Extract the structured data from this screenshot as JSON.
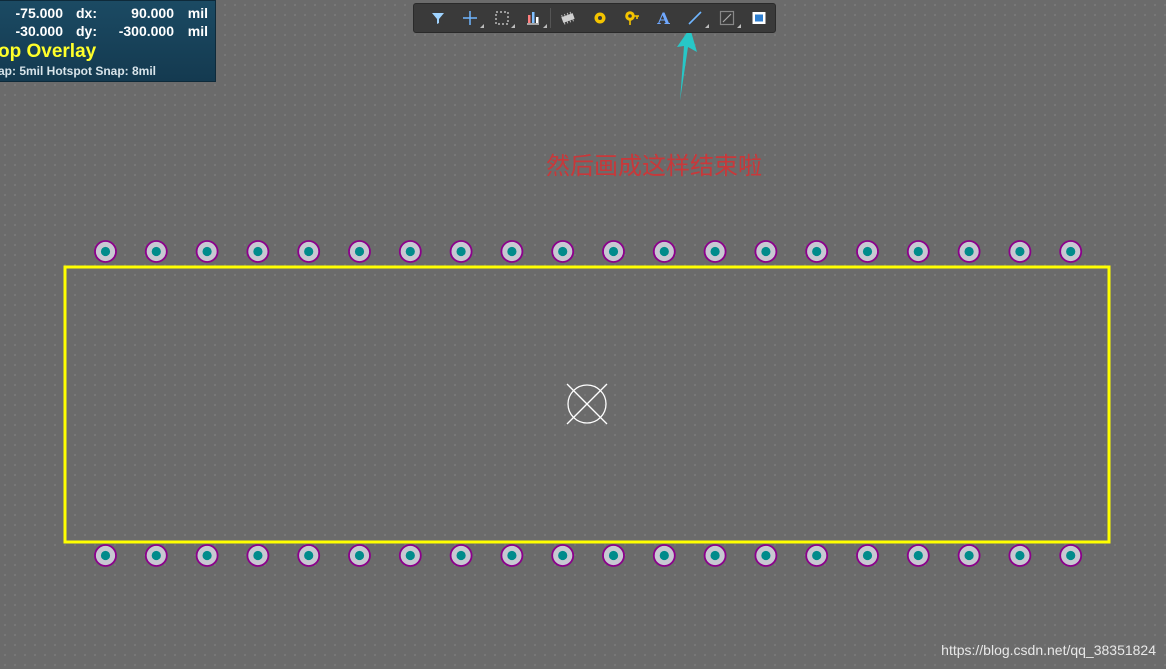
{
  "hud": {
    "row1": {
      "x": "-75.000",
      "dx_label": "dx:",
      "dx": "90.000",
      "unit": "mil"
    },
    "row2": {
      "y": "-30.000",
      "dy_label": "dy:",
      "dy": "-300.000",
      "unit": "mil"
    },
    "layer": "op Overlay",
    "snap": "ap: 5mil Hotspot Snap: 8mil"
  },
  "toolbar": {
    "buttons": [
      {
        "icon": "filter-icon",
        "has_dropdown": false
      },
      {
        "icon": "crosshair-icon",
        "has_dropdown": true
      },
      {
        "icon": "select-rect-icon",
        "has_dropdown": true
      },
      {
        "icon": "align-icon",
        "has_dropdown": true
      },
      {
        "icon": "component-icon",
        "has_dropdown": false
      },
      {
        "icon": "pad-icon",
        "has_dropdown": false
      },
      {
        "icon": "via-icon",
        "has_dropdown": false
      },
      {
        "icon": "text-icon",
        "glyph": "A",
        "has_dropdown": false
      },
      {
        "icon": "line-icon",
        "has_dropdown": true,
        "active": true
      },
      {
        "icon": "dimension-icon",
        "has_dropdown": true
      },
      {
        "icon": "region-icon",
        "has_dropdown": false
      }
    ]
  },
  "annotation": {
    "text": "然后画成这样结束啦"
  },
  "footprint": {
    "pins_per_row": 20,
    "rows": 2,
    "outline_color": "#ffff00",
    "pad_fill": "#c8c8d2",
    "pad_ring": "#8b008b",
    "pad_hole": "#008b8b",
    "arrow_color": "#27c7c7",
    "origin_color": "#ffffff"
  },
  "watermark": {
    "text": "https://blog.csdn.net/qq_38351824"
  }
}
